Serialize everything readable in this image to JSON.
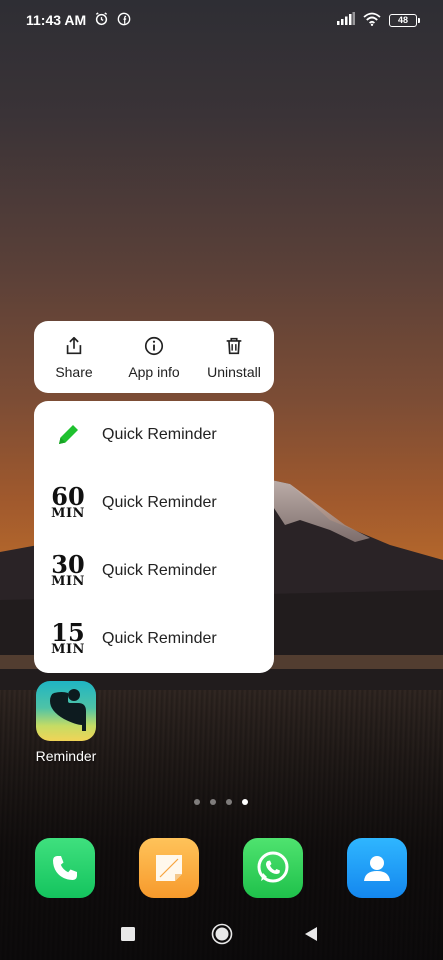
{
  "status_bar": {
    "time": "11:43 AM",
    "battery": "48",
    "icons": [
      "alarm-icon",
      "facebook-icon",
      "signal-icon",
      "wifi-icon",
      "battery-icon"
    ]
  },
  "app_actions": [
    {
      "label": "Share",
      "icon": "share-icon"
    },
    {
      "label": "App info",
      "icon": "info-icon"
    },
    {
      "label": "Uninstall",
      "icon": "trash-icon"
    }
  ],
  "shortcuts": [
    {
      "label": "Quick Reminder",
      "icon": "pencil-icon"
    },
    {
      "label": "Quick Reminder",
      "icon_num": "60",
      "icon_unit": "MIN"
    },
    {
      "label": "Quick Reminder",
      "icon_num": "30",
      "icon_unit": "MIN"
    },
    {
      "label": "Quick Reminder",
      "icon_num": "15",
      "icon_unit": "MIN"
    }
  ],
  "app": {
    "label": "Reminder"
  },
  "page_indicator": {
    "count": 4,
    "active": 4
  },
  "dock": [
    "phone-icon",
    "notes-icon",
    "whatsapp-icon",
    "contacts-icon"
  ],
  "colors": {
    "pencil": "#1fc12f",
    "popup_bg": "#ffffff"
  }
}
